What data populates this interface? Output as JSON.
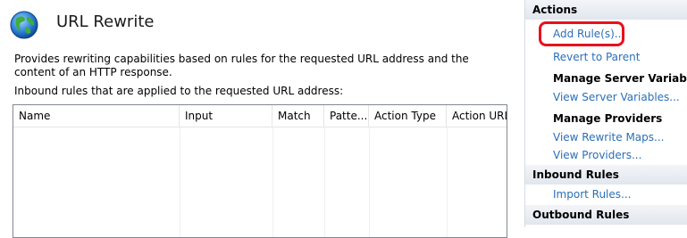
{
  "page": {
    "title": "URL Rewrite",
    "description": "Provides rewriting capabilities based on rules for the requested URL address and the content of an HTTP response.",
    "inbound_caption": "Inbound rules that are applied to the requested URL address:"
  },
  "grid": {
    "columns": [
      "Name",
      "Input",
      "Match",
      "Patte...",
      "Action Type",
      "Action URL"
    ]
  },
  "actions": {
    "heading": "Actions",
    "add_rules": "Add Rule(s)...",
    "revert": "Revert to Parent",
    "server_vars_heading": "Manage Server Variables",
    "view_server_vars": "View Server Variables...",
    "providers_heading": "Manage Providers",
    "view_rewrite_maps": "View Rewrite Maps...",
    "view_providers": "View Providers...",
    "inbound_heading": "Inbound Rules",
    "import_rules": "Import Rules...",
    "outbound_heading": "Outbound Rules"
  },
  "colors": {
    "link": "#2b6fb6",
    "highlight": "#e8111d",
    "section_bg": "#e1e6ee"
  },
  "icons": {
    "feature": "globe-icon"
  }
}
